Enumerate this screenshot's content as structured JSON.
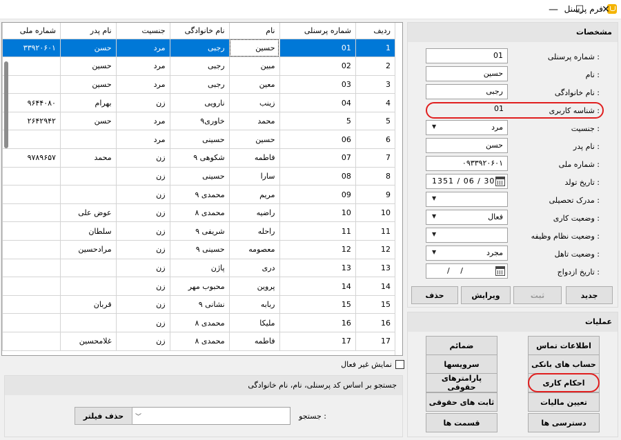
{
  "window": {
    "title": "فرم پرسنل",
    "min": "—",
    "max": "☐",
    "close": "✕"
  },
  "grid": {
    "headers": [
      "ردیف",
      "شماره پرسنلی",
      "نام",
      "نام خانوادگی",
      "جنسیت",
      "نام پدر",
      "شماره ملی"
    ],
    "rows": [
      [
        "1",
        "01",
        "حسین",
        "رجبی",
        "مرد",
        "حسن",
        "۳۳۹۲۰۶۰۱"
      ],
      [
        "2",
        "02",
        "مبین",
        "رجبی",
        "مرد",
        "حسین",
        ""
      ],
      [
        "3",
        "03",
        "معین",
        "رجبی",
        "مرد",
        "حسین",
        ""
      ],
      [
        "4",
        "04",
        "زینب",
        "نارویی",
        "زن",
        "بهرام",
        "۹۶۴۴۰۸۰"
      ],
      [
        "5",
        "5",
        "محمد",
        "خاوری۹",
        "مرد",
        "حسن",
        "۲۶۴۲۹۴۲"
      ],
      [
        "6",
        "06",
        "حسین",
        "حسینی",
        "مرد",
        "",
        ""
      ],
      [
        "7",
        "07",
        "فاطمه",
        "شکوهی ۹",
        "زن",
        "محمد",
        "۹۷۸۹۶۵۷"
      ],
      [
        "8",
        "08",
        "سارا",
        "حسینی",
        "زن",
        "",
        ""
      ],
      [
        "9",
        "09",
        "مریم",
        "محمدی ۹",
        "زن",
        "",
        ""
      ],
      [
        "10",
        "10",
        "راضیه",
        "محمدی ۸",
        "زن",
        "عوض علی",
        ""
      ],
      [
        "11",
        "11",
        "راحله",
        "شریفی ۹",
        "زن",
        "سلطان",
        ""
      ],
      [
        "12",
        "12",
        "معصومه",
        "حسینی ۹",
        "زن",
        "مرادحسین",
        ""
      ],
      [
        "13",
        "13",
        "دری",
        "پاژن",
        "زن",
        "",
        ""
      ],
      [
        "14",
        "14",
        "پروین",
        "محبوب مهر",
        "زن",
        "",
        ""
      ],
      [
        "15",
        "15",
        "ربابه",
        "نشانی ۹",
        "زن",
        "قربان",
        ""
      ],
      [
        "16",
        "16",
        "ملیکا",
        "محمدی ۸",
        "زن",
        "",
        ""
      ],
      [
        "17",
        "17",
        "فاطمه",
        "محمدی ۸",
        "زن",
        "غلامحسین",
        ""
      ]
    ]
  },
  "show_inactive": {
    "label": "نمایش غیر فعال",
    "checked": false
  },
  "search": {
    "title": "جستجو بر اساس کد پرسنلی، نام، نام خانوادگی",
    "label": "جستجو :",
    "value": "",
    "clear_button": "حذف فیلتر"
  },
  "details": {
    "title": "مشخصات",
    "fields": {
      "personnel_no": {
        "label": "شماره پرسنلی :",
        "value": "01"
      },
      "first_name": {
        "label": "نام :",
        "value": "حسین"
      },
      "last_name": {
        "label": "نام خانوادگی :",
        "value": "رجبی"
      },
      "user_id": {
        "label": "شناسه کاربری :",
        "value": "01"
      },
      "gender": {
        "label": "جنسیت :",
        "value": "مرد"
      },
      "father_name": {
        "label": "نام پدر :",
        "value": "حسن"
      },
      "national_id": {
        "label": "شماره ملی :",
        "value": "۰۹۳۳۹۲۰۶۰۱"
      },
      "birth_date": {
        "label": "تاریخ تولد :",
        "value": "1351 / 06 / 30"
      },
      "education": {
        "label": "مدرک تحصیلی :",
        "value": ""
      },
      "work_status": {
        "label": "وضعیت کاری :",
        "value": "فعال"
      },
      "military_status": {
        "label": "وضعیت نظام وظیفه :",
        "value": ""
      },
      "marital_status": {
        "label": "وضعیت تاهل :",
        "value": "مجرد"
      },
      "marriage_date": {
        "label": "تاریخ ازدواج :",
        "value": "/     /"
      }
    },
    "buttons": {
      "new": "جدید",
      "save": "ثبت",
      "edit": "ویرایش",
      "delete": "حذف"
    }
  },
  "operations": {
    "title": "عملیات",
    "right_column": [
      "اطلاعات تماس",
      "حساب های بانکی",
      "احکام کاری",
      "تعیین مالیات",
      "دسترسی ها"
    ],
    "left_column": [
      "ضمائم",
      "سرویسها",
      "پارامترهای حقوقی",
      "ثابت های حقوقی",
      "قسمت ها"
    ]
  }
}
